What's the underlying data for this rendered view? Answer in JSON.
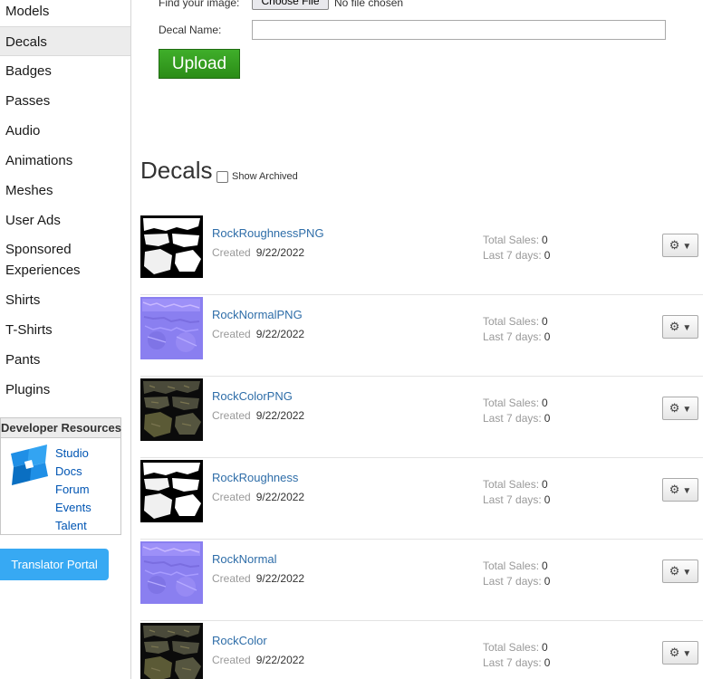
{
  "sidebar": {
    "items": [
      {
        "label": "Models"
      },
      {
        "label": "Decals"
      },
      {
        "label": "Badges"
      },
      {
        "label": "Passes"
      },
      {
        "label": "Audio"
      },
      {
        "label": "Animations"
      },
      {
        "label": "Meshes"
      },
      {
        "label": "User Ads"
      },
      {
        "label": "Sponsored Experiences"
      },
      {
        "label": "Shirts"
      },
      {
        "label": "T-Shirts"
      },
      {
        "label": "Pants"
      },
      {
        "label": "Plugins"
      }
    ],
    "active": "Decals",
    "developer_resources": {
      "title": "Developer Resources",
      "links": [
        "Studio",
        "Docs",
        "Forum",
        "Events",
        "Talent"
      ]
    },
    "translator_portal": "Translator Portal"
  },
  "upload_form": {
    "find_image_label": "Find your image:",
    "choose_file_label": "Choose File",
    "no_file_text": "No file chosen",
    "decal_name_label": "Decal Name:",
    "decal_name_value": "",
    "upload_label": "Upload"
  },
  "section": {
    "title": "Decals",
    "show_archived_label": "Show Archived",
    "show_archived_checked": false
  },
  "decals": [
    {
      "name": "RockRoughnessPNG",
      "created_label": "Created",
      "created": "9/22/2022",
      "total_sales_label": "Total Sales:",
      "total_sales": "0",
      "last7_label": "Last 7 days:",
      "last7": "0",
      "thumb": "roughness"
    },
    {
      "name": "RockNormalPNG",
      "created_label": "Created",
      "created": "9/22/2022",
      "total_sales_label": "Total Sales:",
      "total_sales": "0",
      "last7_label": "Last 7 days:",
      "last7": "0",
      "thumb": "normal"
    },
    {
      "name": "RockColorPNG",
      "created_label": "Created",
      "created": "9/22/2022",
      "total_sales_label": "Total Sales:",
      "total_sales": "0",
      "last7_label": "Last 7 days:",
      "last7": "0",
      "thumb": "color"
    },
    {
      "name": "RockRoughness",
      "created_label": "Created",
      "created": "9/22/2022",
      "total_sales_label": "Total Sales:",
      "total_sales": "0",
      "last7_label": "Last 7 days:",
      "last7": "0",
      "thumb": "roughness"
    },
    {
      "name": "RockNormal",
      "created_label": "Created",
      "created": "9/22/2022",
      "total_sales_label": "Total Sales:",
      "total_sales": "0",
      "last7_label": "Last 7 days:",
      "last7": "0",
      "thumb": "normal"
    },
    {
      "name": "RockColor",
      "created_label": "Created",
      "created": "9/22/2022",
      "total_sales_label": "Total Sales:",
      "total_sales": "0",
      "last7_label": "Last 7 days:",
      "last7": "0",
      "thumb": "color"
    }
  ],
  "colors": {
    "link": "#2e6da8",
    "upload_green": "#2b8c17",
    "translator_blue": "#37a9f3",
    "active_nav_bg": "#ececec"
  },
  "icons": {
    "gear": "gear-icon",
    "dropdown": "caret-down-icon",
    "studio_logo": "roblox-studio-logo"
  }
}
